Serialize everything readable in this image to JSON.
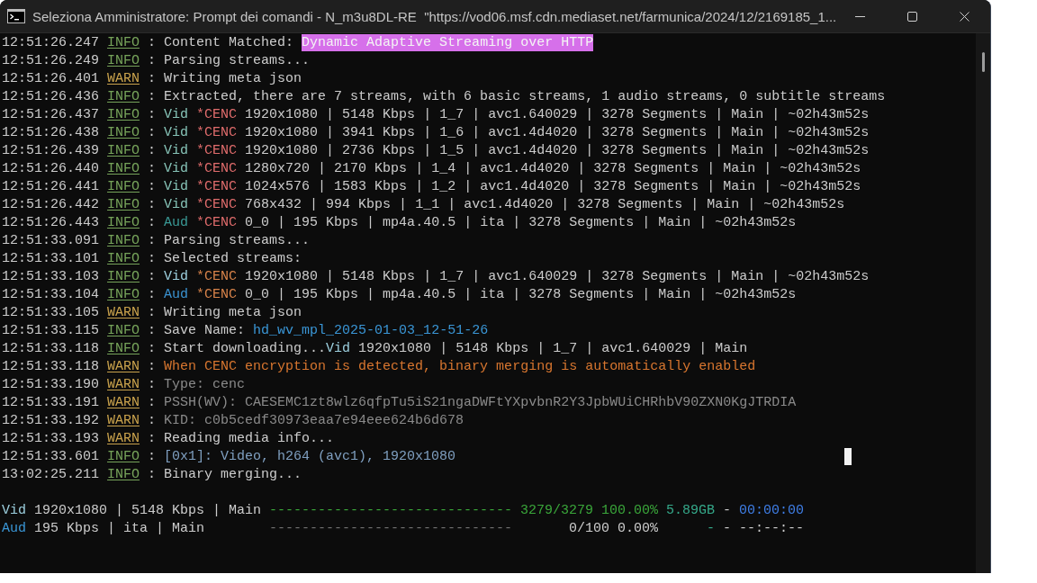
{
  "window": {
    "title": "Seleziona Amministratore: Prompt dei comandi - N_m3u8DL-RE  \"https://vod06.msf.cdn.mediaset.net/farmunica/2024/12/2169185_1..."
  },
  "log": [
    {
      "time": "12:51:26.247",
      "tag": {
        "text": "INFO",
        "color": "#76a35a"
      },
      "separator": ":",
      "message": [
        {
          "text": "Content Matched: ",
          "color": "#cccccc",
          "kind": "text"
        },
        {
          "text": "Dynamic Adaptive Streaming over HTTP",
          "color": "#d670ea",
          "kind": "highlight"
        }
      ]
    },
    {
      "time": "12:51:26.249",
      "tag": {
        "text": "INFO",
        "color": "#76a35a"
      },
      "separator": ":",
      "message": [
        {
          "text": "Parsing streams...",
          "color": "#cccccc"
        }
      ]
    },
    {
      "time": "12:51:26.401",
      "tag": {
        "text": "WARN",
        "color": "#c9a24c"
      },
      "separator": ":",
      "message": [
        {
          "text": "Writing meta json",
          "color": "#cccccc"
        }
      ]
    },
    {
      "time": "12:51:26.436",
      "tag": {
        "text": "INFO",
        "color": "#76a35a"
      },
      "separator": ":",
      "message": [
        {
          "text": "Extracted, there are 7 streams, with 6 basic streams, 1 audio streams, 0 subtitle streams",
          "color": "#cccccc"
        }
      ]
    },
    {
      "time": "12:51:26.437",
      "tag": {
        "text": "INFO",
        "color": "#76a35a"
      },
      "separator": ":",
      "message": [
        {
          "text": "Vid",
          "color": "#87c4b8"
        },
        {
          "text": " *CENC",
          "color": "#e06c6c"
        },
        {
          "text": " 1920x1080 | 5148 Kbps | 1_7 | avc1.640029 | 3278 Segments | Main | ~02h43m52s",
          "color": "#cccccc"
        }
      ]
    },
    {
      "time": "12:51:26.438",
      "tag": {
        "text": "INFO",
        "color": "#76a35a"
      },
      "separator": ":",
      "message": [
        {
          "text": "Vid",
          "color": "#87c4b8"
        },
        {
          "text": " *CENC",
          "color": "#e06c6c"
        },
        {
          "text": " 1920x1080 | 3941 Kbps | 1_6 | avc1.4d4020 | 3278 Segments | Main | ~02h43m52s",
          "color": "#cccccc"
        }
      ]
    },
    {
      "time": "12:51:26.439",
      "tag": {
        "text": "INFO",
        "color": "#76a35a"
      },
      "separator": ":",
      "message": [
        {
          "text": "Vid",
          "color": "#87c4b8"
        },
        {
          "text": " *CENC",
          "color": "#e06c6c"
        },
        {
          "text": " 1920x1080 | 2736 Kbps | 1_5 | avc1.4d4020 | 3278 Segments | Main | ~02h43m52s",
          "color": "#cccccc"
        }
      ]
    },
    {
      "time": "12:51:26.440",
      "tag": {
        "text": "INFO",
        "color": "#76a35a"
      },
      "separator": ":",
      "message": [
        {
          "text": "Vid",
          "color": "#87c4b8"
        },
        {
          "text": " *CENC",
          "color": "#e06c6c"
        },
        {
          "text": " 1280x720 | 2170 Kbps | 1_4 | avc1.4d4020 | 3278 Segments | Main | ~02h43m52s",
          "color": "#cccccc"
        }
      ]
    },
    {
      "time": "12:51:26.441",
      "tag": {
        "text": "INFO",
        "color": "#76a35a"
      },
      "separator": ":",
      "message": [
        {
          "text": "Vid",
          "color": "#87c4b8"
        },
        {
          "text": " *CENC",
          "color": "#e06c6c"
        },
        {
          "text": " 1024x576 | 1583 Kbps | 1_2 | avc1.4d4020 | 3278 Segments | Main | ~02h43m52s",
          "color": "#cccccc"
        }
      ]
    },
    {
      "time": "12:51:26.442",
      "tag": {
        "text": "INFO",
        "color": "#76a35a"
      },
      "separator": ":",
      "message": [
        {
          "text": "Vid",
          "color": "#87c4b8"
        },
        {
          "text": " *CENC",
          "color": "#e06c6c"
        },
        {
          "text": " 768x432 | 994 Kbps | 1_1 | avc1.4d4020 | 3278 Segments | Main | ~02h43m52s",
          "color": "#cccccc"
        }
      ]
    },
    {
      "time": "12:51:26.443",
      "tag": {
        "text": "INFO",
        "color": "#76a35a"
      },
      "separator": ":",
      "message": [
        {
          "text": "Aud",
          "color": "#3a9a96"
        },
        {
          "text": " *CENC",
          "color": "#e06c6c"
        },
        {
          "text": " 0_0 | 195 Kbps | mp4a.40.5 | ita | 3278 Segments | Main | ~02h43m52s",
          "color": "#cccccc"
        }
      ]
    },
    {
      "time": "12:51:33.091",
      "tag": {
        "text": "INFO",
        "color": "#76a35a"
      },
      "separator": ":",
      "message": [
        {
          "text": "Parsing streams...",
          "color": "#cccccc"
        }
      ]
    },
    {
      "time": "12:51:33.101",
      "tag": {
        "text": "INFO",
        "color": "#76a35a"
      },
      "separator": ":",
      "message": [
        {
          "text": "Selected streams:",
          "color": "#cccccc"
        }
      ]
    },
    {
      "time": "12:51:33.103",
      "tag": {
        "text": "INFO",
        "color": "#76a35a"
      },
      "separator": ":",
      "message": [
        {
          "text": "Vid",
          "color": "#9dd0df"
        },
        {
          "text": " *CENC",
          "color": "#d8834a"
        },
        {
          "text": " 1920x1080 | 5148 Kbps | 1_7 | avc1.640029 | 3278 Segments | Main | ~02h43m52s",
          "color": "#cccccc"
        }
      ]
    },
    {
      "time": "12:51:33.104",
      "tag": {
        "text": "INFO",
        "color": "#76a35a"
      },
      "separator": ":",
      "message": [
        {
          "text": "Aud",
          "color": "#3a92d0"
        },
        {
          "text": " *CENC",
          "color": "#d8834a"
        },
        {
          "text": " 0_0 | 195 Kbps | mp4a.40.5 | ita | 3278 Segments | Main | ~02h43m52s",
          "color": "#cccccc"
        }
      ]
    },
    {
      "time": "12:51:33.105",
      "tag": {
        "text": "WARN",
        "color": "#c9a24c"
      },
      "separator": ":",
      "message": [
        {
          "text": "Writing meta json",
          "color": "#cccccc"
        }
      ]
    },
    {
      "time": "12:51:33.115",
      "tag": {
        "text": "INFO",
        "color": "#76a35a"
      },
      "separator": ":",
      "message": [
        {
          "text": "Save Name: ",
          "color": "#cccccc"
        },
        {
          "text": "hd_wv_mpl_2025-01-03_12-51-26",
          "color": "#3a96d6"
        }
      ]
    },
    {
      "time": "12:51:33.118",
      "tag": {
        "text": "INFO",
        "color": "#76a35a"
      },
      "separator": ":",
      "message": [
        {
          "text": "Start downloading...",
          "color": "#cccccc"
        },
        {
          "text": "Vid",
          "color": "#9dd0df"
        },
        {
          "text": " 1920x1080 | 5148 Kbps | 1_7 | avc1.640029 | Main",
          "color": "#cccccc"
        }
      ]
    },
    {
      "time": "12:51:33.118",
      "tag": {
        "text": "WARN",
        "color": "#c9a24c"
      },
      "separator": ":",
      "message": [
        {
          "text": "When CENC encryption is detected, binary merging is automatically enabled",
          "color": "#d8762f"
        }
      ]
    },
    {
      "time": "12:51:33.190",
      "tag": {
        "text": "WARN",
        "color": "#c9a24c"
      },
      "separator": ":",
      "message": [
        {
          "text": "Type: cenc",
          "color": "#8a8a8a"
        }
      ]
    },
    {
      "time": "12:51:33.191",
      "tag": {
        "text": "WARN",
        "color": "#c9a24c"
      },
      "separator": ":",
      "message": [
        {
          "text": "PSSH(WV): CAESEMC1zt8wlz6qfpTu5iS21ngaDWFtYXpvbnR2Y3JpbWUiCHRhbV90ZXN0KgJTRDIA",
          "color": "#8a8a8a"
        }
      ]
    },
    {
      "time": "12:51:33.192",
      "tag": {
        "text": "WARN",
        "color": "#c9a24c"
      },
      "separator": ":",
      "message": [
        {
          "text": "KID: c0b5cedf30973eaa7e94eee624b6d678",
          "color": "#8a8a8a"
        }
      ]
    },
    {
      "time": "12:51:33.193",
      "tag": {
        "text": "WARN",
        "color": "#c9a24c"
      },
      "separator": ":",
      "message": [
        {
          "text": "Reading media info...",
          "color": "#cccccc"
        }
      ]
    },
    {
      "time": "12:51:33.601",
      "tag": {
        "text": "INFO",
        "color": "#76a35a"
      },
      "separator": ":",
      "message": [
        {
          "text": "[0x1]: Video, h264 (avc1), 1920x1080",
          "color": "#7f9fc0"
        }
      ]
    },
    {
      "time": "13:02:25.211",
      "tag": {
        "text": "INFO",
        "color": "#76a35a"
      },
      "separator": ":",
      "message": [
        {
          "text": "Binary merging...",
          "color": "#cccccc"
        }
      ]
    }
  ],
  "progress": [
    {
      "stream": [
        {
          "text": "Vid",
          "color": "#9dd0df"
        },
        {
          "text": " 1920x1080 | 5148 Kbps | Main",
          "color": "#cccccc"
        }
      ],
      "bar": {
        "text": "------------------------------",
        "color": "#3aa63a"
      },
      "count": {
        "text": "3279/3279",
        "color": "#3aa63a"
      },
      "percent": {
        "text": "100.00%",
        "color": "#3aa63a"
      },
      "size": {
        "text": "5.89GB",
        "color": "#35a98a"
      },
      "separator": {
        "text": "-",
        "color": "#cccccc"
      },
      "eta": {
        "text": "00:00:00",
        "color": "#3f7fe8"
      }
    },
    {
      "stream": [
        {
          "text": "Aud",
          "color": "#3a96d6"
        },
        {
          "text": " 195 Kbps | ita | Main",
          "color": "#cccccc"
        }
      ],
      "bar": {
        "text": "------------------------------",
        "color": "#707070"
      },
      "count": {
        "text": "0/100",
        "color": "#cccccc"
      },
      "percent": {
        "text": "0.00%",
        "color": "#cccccc"
      },
      "size": {
        "text": "-",
        "color": "#35a98a"
      },
      "separator": {
        "text": "-",
        "color": "#cccccc"
      },
      "eta": {
        "text": "--:--:--",
        "color": "#cccccc"
      }
    }
  ]
}
